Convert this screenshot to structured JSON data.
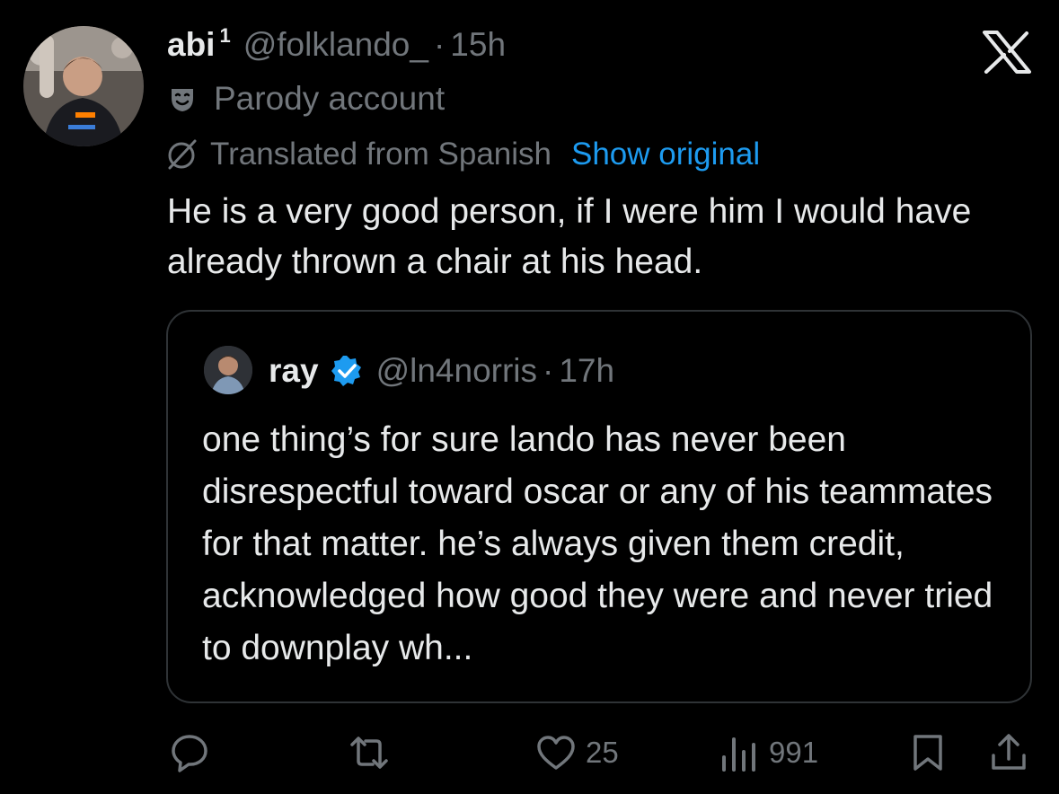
{
  "tweet": {
    "display_name": "abi",
    "name_superscript": "1",
    "handle": "@folklando_",
    "separator": "·",
    "time": "15h",
    "label": "Parody account",
    "translated_from": "Translated from Spanish",
    "show_original": "Show original",
    "text": "He is a very good person, if I were him I would have already thrown a chair at his head."
  },
  "quoted_tweet": {
    "display_name": "ray",
    "verified": true,
    "handle": "@ln4norris",
    "separator": "·",
    "time": "17h",
    "text": "one thing’s for sure lando has never been disrespectful toward oscar or any of his teammates for that matter. he’s always given them credit, acknowledged how good they were and never tried to downplay wh..."
  },
  "actions": {
    "reply_count": "",
    "repost_count": "",
    "like_count": "25",
    "view_count": "991"
  },
  "icons": {
    "brand": "x-logo-icon",
    "label_icon": "parody-mask-icon",
    "translate_icon": "translate-icon",
    "verified_icon": "verified-badge-icon",
    "reply": "reply-icon",
    "repost": "repost-icon",
    "like": "heart-icon",
    "views": "views-icon",
    "bookmark": "bookmark-icon",
    "share": "share-icon"
  },
  "colors": {
    "background": "#000000",
    "text_primary": "#e7e9ea",
    "text_secondary": "#71767b",
    "link": "#1d9bf0",
    "border": "#2f3336"
  }
}
